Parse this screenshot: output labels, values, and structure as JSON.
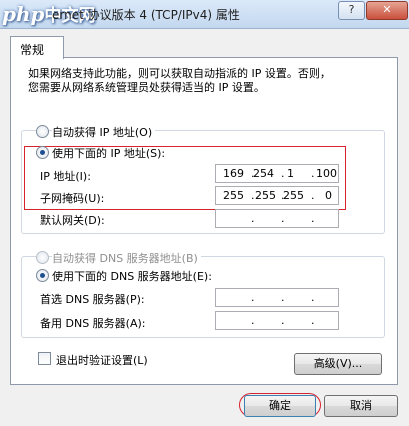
{
  "window": {
    "title": "ernet 协议版本 4 (TCP/IPv4) 属性",
    "logo_text": "php",
    "logo_cn": "中文网",
    "help_label": "?",
    "close_label": "✕"
  },
  "tab": {
    "general": "常规"
  },
  "description": {
    "line1": "如果网络支持此功能，则可以获取自动指派的 IP 设置。否则，",
    "line2": "您需要从网络系统管理员处获得适当的 IP 设置。"
  },
  "ip_section": {
    "auto_label": "自动获得 IP 地址(O)",
    "manual_label": "使用下面的 IP 地址(S):",
    "ip_label": "IP 地址(I):",
    "ip_value": [
      "169",
      "254",
      "1",
      "100"
    ],
    "mask_label": "子网掩码(U):",
    "mask_value": [
      "255",
      "255",
      "255",
      "0"
    ],
    "gateway_label": "默认网关(D):",
    "gateway_value": [
      "",
      "",
      "",
      ""
    ]
  },
  "dns_section": {
    "auto_label": "自动获得 DNS 服务器地址(B)",
    "manual_label": "使用下面的 DNS 服务器地址(E):",
    "preferred_label": "首选 DNS 服务器(P):",
    "preferred_value": [
      "",
      "",
      "",
      ""
    ],
    "alternate_label": "备用 DNS 服务器(A):",
    "alternate_value": [
      "",
      "",
      "",
      ""
    ]
  },
  "validate_label": "退出时验证设置(L)",
  "advanced_label": "高级(V)...",
  "ok_label": "确定",
  "cancel_label": "取消",
  "colors": {
    "highlight_box": "#d6232e",
    "dot": "."
  }
}
